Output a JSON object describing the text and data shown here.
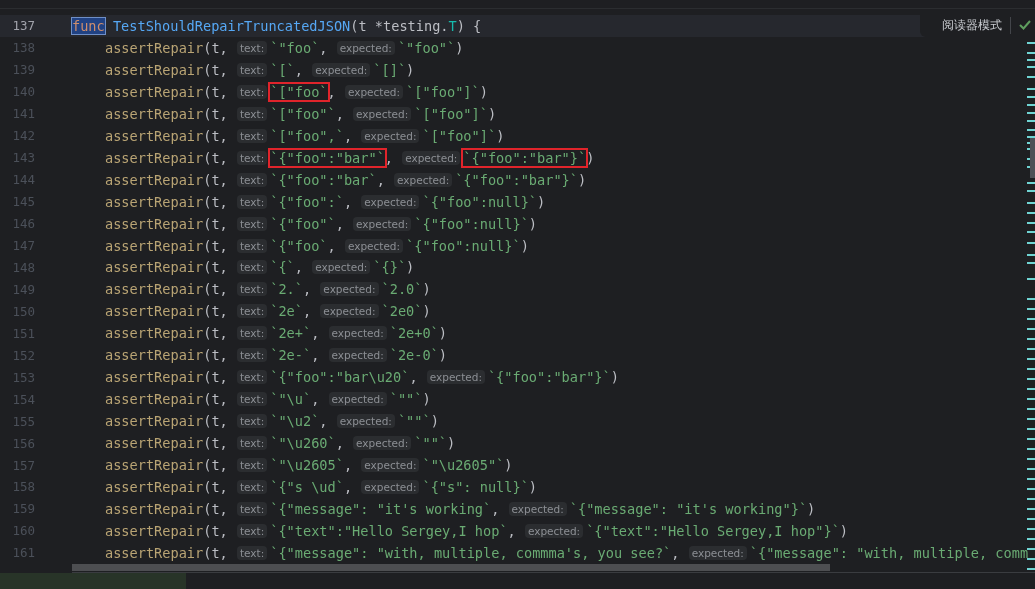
{
  "reader_mode": {
    "label": "阅读器模式"
  },
  "status_bar": {
    "progress": {
      "level": 0.18
    }
  },
  "header": {
    "number": "137",
    "tokens": [
      {
        "kind": "keyword",
        "text": "func",
        "selected": true
      },
      {
        "kind": "function",
        "text": "TestShouldRepairTruncatedJSON"
      },
      {
        "kind": "plain",
        "text": "(t *"
      },
      {
        "kind": "type",
        "text": "testing"
      },
      {
        "kind": "plain",
        "text": "."
      },
      {
        "kind": "typename",
        "text": "T"
      },
      {
        "kind": "plain",
        "text": ") {"
      }
    ]
  },
  "lines": [
    {
      "number": "138",
      "call": "assertRepair",
      "args": "(t, ",
      "text_hint": "text:",
      "text_arg": "`\"foo`",
      "text_boxed": false,
      "sep": ", ",
      "expected_hint": "expected:",
      "expected_arg": "`\"foo\"`",
      "expected_boxed": false,
      "close": ")"
    },
    {
      "number": "139",
      "call": "assertRepair",
      "args": "(t, ",
      "text_hint": "text:",
      "text_arg": "`[`",
      "text_boxed": false,
      "sep": ", ",
      "expected_hint": "expected:",
      "expected_arg": "`[]`",
      "expected_boxed": false,
      "close": ")"
    },
    {
      "number": "140",
      "call": "assertRepair",
      "args": "(t, ",
      "text_hint": "text:",
      "text_arg": "`[\"foo`",
      "text_boxed": true,
      "sep": ", ",
      "expected_hint": "expected:",
      "expected_arg": "`[\"foo\"]`",
      "expected_boxed": false,
      "close": ")"
    },
    {
      "number": "141",
      "call": "assertRepair",
      "args": "(t, ",
      "text_hint": "text:",
      "text_arg": "`[\"foo\"`",
      "text_boxed": false,
      "sep": ", ",
      "expected_hint": "expected:",
      "expected_arg": "`[\"foo\"]`",
      "expected_boxed": false,
      "close": ")"
    },
    {
      "number": "142",
      "call": "assertRepair",
      "args": "(t, ",
      "text_hint": "text:",
      "text_arg": "`[\"foo\",`",
      "text_boxed": false,
      "sep": ", ",
      "expected_hint": "expected:",
      "expected_arg": "`[\"foo\"]`",
      "expected_boxed": false,
      "close": ")"
    },
    {
      "number": "143",
      "call": "assertRepair",
      "args": "(t, ",
      "text_hint": "text:",
      "text_arg": "`{\"foo\":\"bar\"`",
      "text_boxed": true,
      "sep": ", ",
      "expected_hint": "expected:",
      "expected_arg": "`{\"foo\":\"bar\"}`",
      "expected_boxed": true,
      "close": ")"
    },
    {
      "number": "144",
      "call": "assertRepair",
      "args": "(t, ",
      "text_hint": "text:",
      "text_arg": "`{\"foo\":\"bar`",
      "text_boxed": false,
      "sep": ", ",
      "expected_hint": "expected:",
      "expected_arg": "`{\"foo\":\"bar\"}`",
      "expected_boxed": false,
      "close": ")"
    },
    {
      "number": "145",
      "call": "assertRepair",
      "args": "(t, ",
      "text_hint": "text:",
      "text_arg": "`{\"foo\":`",
      "text_boxed": false,
      "sep": ", ",
      "expected_hint": "expected:",
      "expected_arg": "`{\"foo\":null}`",
      "expected_boxed": false,
      "close": ")"
    },
    {
      "number": "146",
      "call": "assertRepair",
      "args": "(t, ",
      "text_hint": "text:",
      "text_arg": "`{\"foo\"`",
      "text_boxed": false,
      "sep": ", ",
      "expected_hint": "expected:",
      "expected_arg": "`{\"foo\":null}`",
      "expected_boxed": false,
      "close": ")"
    },
    {
      "number": "147",
      "call": "assertRepair",
      "args": "(t, ",
      "text_hint": "text:",
      "text_arg": "`{\"foo`",
      "text_boxed": false,
      "sep": ", ",
      "expected_hint": "expected:",
      "expected_arg": "`{\"foo\":null}`",
      "expected_boxed": false,
      "close": ")"
    },
    {
      "number": "148",
      "call": "assertRepair",
      "args": "(t, ",
      "text_hint": "text:",
      "text_arg": "`{`",
      "text_boxed": false,
      "sep": ", ",
      "expected_hint": "expected:",
      "expected_arg": "`{}`",
      "expected_boxed": false,
      "close": ")"
    },
    {
      "number": "149",
      "call": "assertRepair",
      "args": "(t, ",
      "text_hint": "text:",
      "text_arg": "`2.`",
      "text_boxed": false,
      "sep": ", ",
      "expected_hint": "expected:",
      "expected_arg": "`2.0`",
      "expected_boxed": false,
      "close": ")"
    },
    {
      "number": "150",
      "call": "assertRepair",
      "args": "(t, ",
      "text_hint": "text:",
      "text_arg": "`2e`",
      "text_boxed": false,
      "sep": ", ",
      "expected_hint": "expected:",
      "expected_arg": "`2e0`",
      "expected_boxed": false,
      "close": ")"
    },
    {
      "number": "151",
      "call": "assertRepair",
      "args": "(t, ",
      "text_hint": "text:",
      "text_arg": "`2e+`",
      "text_boxed": false,
      "sep": ", ",
      "expected_hint": "expected:",
      "expected_arg": "`2e+0`",
      "expected_boxed": false,
      "close": ")"
    },
    {
      "number": "152",
      "call": "assertRepair",
      "args": "(t, ",
      "text_hint": "text:",
      "text_arg": "`2e-`",
      "text_boxed": false,
      "sep": ", ",
      "expected_hint": "expected:",
      "expected_arg": "`2e-0`",
      "expected_boxed": false,
      "close": ")"
    },
    {
      "number": "153",
      "call": "assertRepair",
      "args": "(t, ",
      "text_hint": "text:",
      "text_arg": "`{\"foo\":\"bar\\u20`",
      "text_boxed": false,
      "sep": ", ",
      "expected_hint": "expected:",
      "expected_arg": "`{\"foo\":\"bar\"}`",
      "expected_boxed": false,
      "close": ")"
    },
    {
      "number": "154",
      "call": "assertRepair",
      "args": "(t, ",
      "text_hint": "text:",
      "text_arg": "`\"\\u`",
      "text_boxed": false,
      "sep": ", ",
      "expected_hint": "expected:",
      "expected_arg": "`\"\"`",
      "expected_boxed": false,
      "close": ")"
    },
    {
      "number": "155",
      "call": "assertRepair",
      "args": "(t, ",
      "text_hint": "text:",
      "text_arg": "`\"\\u2`",
      "text_boxed": false,
      "sep": ", ",
      "expected_hint": "expected:",
      "expected_arg": "`\"\"`",
      "expected_boxed": false,
      "close": ")"
    },
    {
      "number": "156",
      "call": "assertRepair",
      "args": "(t, ",
      "text_hint": "text:",
      "text_arg": "`\"\\u260`",
      "text_boxed": false,
      "sep": ", ",
      "expected_hint": "expected:",
      "expected_arg": "`\"\"`",
      "expected_boxed": false,
      "close": ")"
    },
    {
      "number": "157",
      "call": "assertRepair",
      "args": "(t, ",
      "text_hint": "text:",
      "text_arg": "`\"\\u2605`",
      "text_boxed": false,
      "sep": ", ",
      "expected_hint": "expected:",
      "expected_arg": "`\"\\u2605\"`",
      "expected_boxed": false,
      "close": ")"
    },
    {
      "number": "158",
      "call": "assertRepair",
      "args": "(t, ",
      "text_hint": "text:",
      "text_arg": "`{\"s \\ud`",
      "text_boxed": false,
      "sep": ", ",
      "expected_hint": "expected:",
      "expected_arg": "`{\"s\": null}`",
      "expected_boxed": false,
      "close": ")"
    },
    {
      "number": "159",
      "call": "assertRepair",
      "args": "(t, ",
      "text_hint": "text:",
      "text_arg": "`{\"message\": \"it's working`",
      "text_boxed": false,
      "sep": ", ",
      "expected_hint": "expected:",
      "expected_arg": "`{\"message\": \"it's working\"}`",
      "expected_boxed": false,
      "close": ")"
    },
    {
      "number": "160",
      "call": "assertRepair",
      "args": "(t, ",
      "text_hint": "text:",
      "text_arg": "`{\"text\":\"Hello Sergey,I hop`",
      "text_boxed": false,
      "sep": ", ",
      "expected_hint": "expected:",
      "expected_arg": "`{\"text\":\"Hello Sergey,I hop\"}`",
      "expected_boxed": false,
      "close": ")"
    },
    {
      "number": "161",
      "call": "assertRepair",
      "args": "(t, ",
      "text_hint": "text:",
      "text_arg": "`{\"message\": \"with, multiple, commma's, you see?`",
      "text_boxed": false,
      "sep": ", ",
      "expected_hint": "expected:",
      "expected_arg": "`{\"message\": \"with, multiple, comm",
      "expected_boxed": false
    }
  ]
}
